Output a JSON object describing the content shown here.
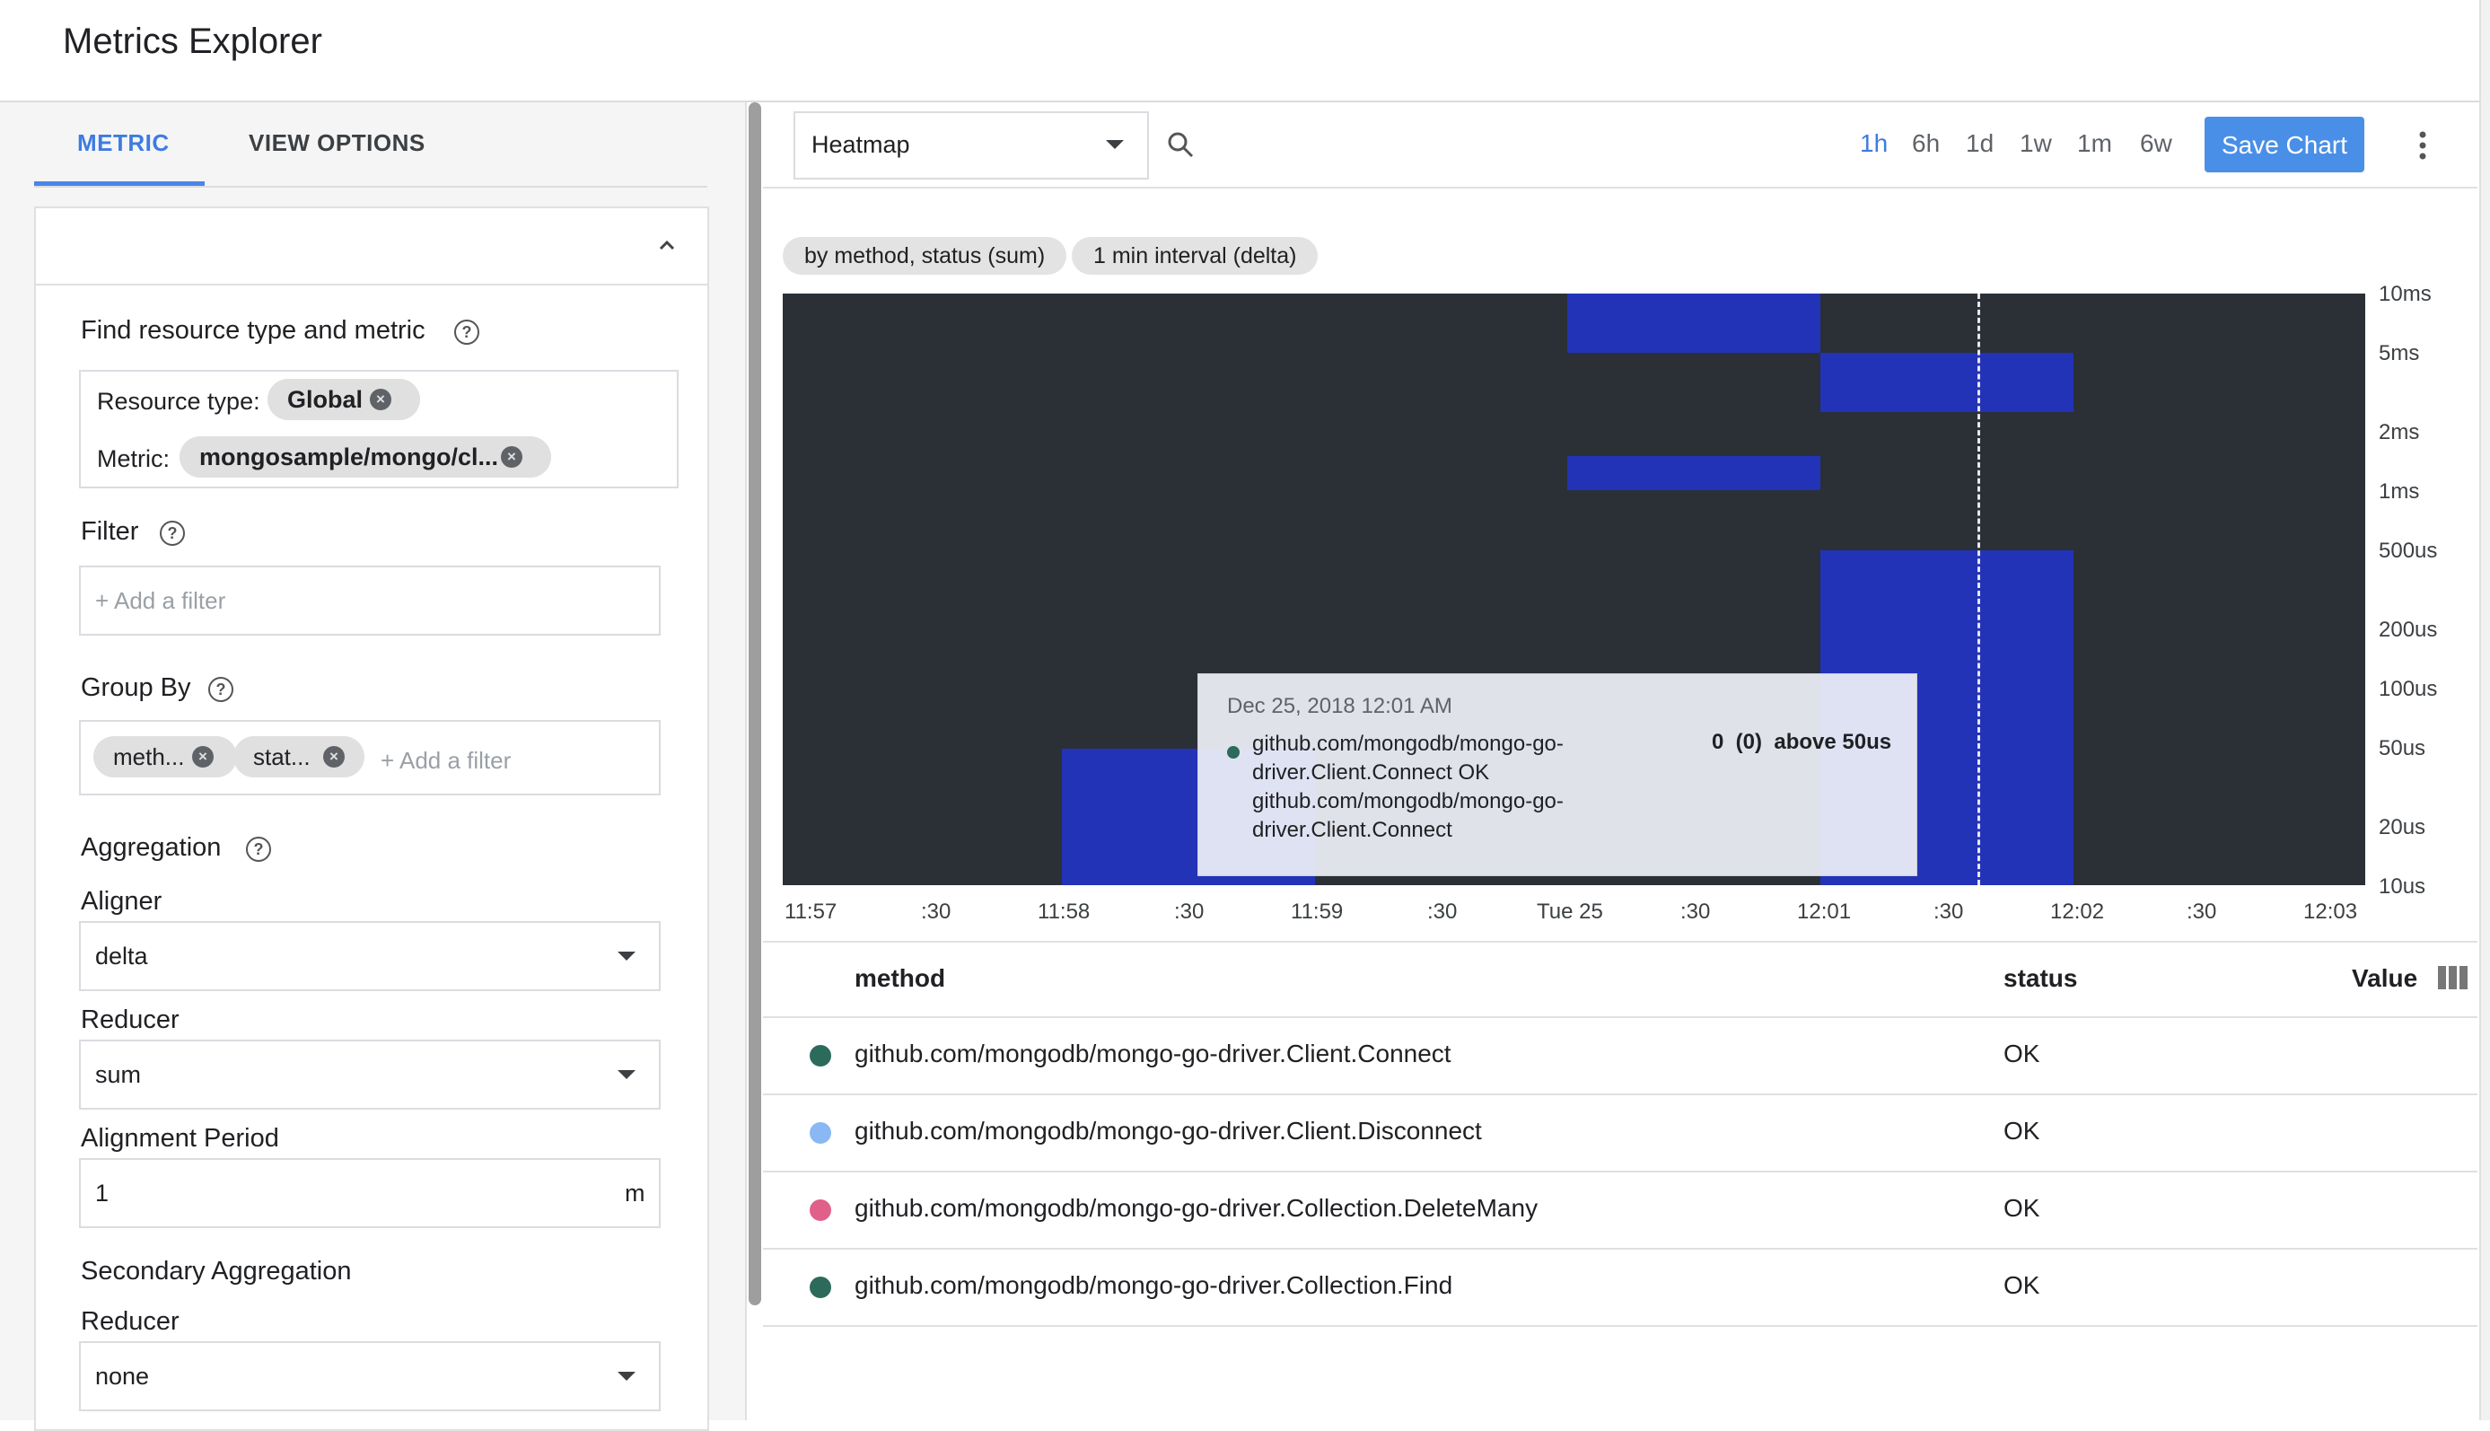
{
  "header": {
    "title": "Metrics Explorer"
  },
  "left": {
    "tabs": [
      "METRIC",
      "VIEW OPTIONS"
    ],
    "find_label": "Find resource type and metric",
    "resource_type_label": "Resource type:",
    "resource_type_value": "Global",
    "metric_label": "Metric:",
    "metric_value": "mongosample/mongo/cl...",
    "filter_label": "Filter",
    "filter_placeholder": "+ Add a filter",
    "group_by_label": "Group By",
    "group_by_chips": [
      "meth...",
      "stat..."
    ],
    "group_by_placeholder": "+ Add a filter",
    "aggregation_label": "Aggregation",
    "aligner_label": "Aligner",
    "aligner_value": "delta",
    "reducer_label": "Reducer",
    "reducer_value": "sum",
    "alignment_period_label": "Alignment Period",
    "alignment_period_value": "1",
    "alignment_period_unit": "m",
    "secondary_label": "Secondary Aggregation",
    "secondary_reducer_label": "Reducer",
    "secondary_reducer_value": "none"
  },
  "toolbar": {
    "chart_type": "Heatmap",
    "ranges": [
      "1h",
      "6h",
      "1d",
      "1w",
      "1m",
      "6w"
    ],
    "active_range": "1h",
    "save_label": "Save Chart"
  },
  "pills": [
    "by method, status (sum)",
    "1 min interval (delta)"
  ],
  "chart_data": {
    "type": "heatmap",
    "x_ticks": [
      "11:57",
      ":30",
      "11:58",
      ":30",
      "11:59",
      ":30",
      "Tue 25",
      ":30",
      "12:01",
      ":30",
      "12:02",
      ":30",
      "12:03"
    ],
    "y_ticks": [
      "10ms",
      "5ms",
      "2ms",
      "1ms",
      "500us",
      "200us",
      "100us",
      "50us",
      "20us",
      "10us"
    ],
    "y_scale": "log",
    "cells": [
      {
        "x_start": "11:57:30",
        "x_end": "11:58:30",
        "y_low": "10us",
        "y_high": "50us"
      },
      {
        "x_start": "Tue 25 00:00",
        "x_end": "12:01",
        "y_low": "5ms",
        "y_high": "10ms"
      },
      {
        "x_start": "Tue 25 00:00",
        "x_end": "12:01",
        "y_low": "1ms",
        "y_high": "2ms"
      },
      {
        "x_start": "12:01",
        "x_end": "12:02",
        "y_low": "2ms",
        "y_high": "5ms"
      },
      {
        "x_start": "12:01",
        "x_end": "12:02",
        "y_low": "10us",
        "y_high": "500us"
      }
    ],
    "cursor": "12:01:30",
    "colors": {
      "background": "#2a3036",
      "cell": "#2233b8"
    }
  },
  "tooltip": {
    "time": "Dec 25, 2018 12:01 AM",
    "series": "github.com/mongodb/mongo-go-driver.Client.Connect OK github.com/mongodb/mongo-go-driver.Client.Connect",
    "value": "0  (0)  above 50us"
  },
  "table": {
    "headers": [
      "method",
      "status",
      "Value"
    ],
    "rows": [
      {
        "method": "github.com/mongodb/mongo-go-driver.Client.Connect",
        "status": "OK",
        "color": "#2c6b5b"
      },
      {
        "method": "github.com/mongodb/mongo-go-driver.Client.Disconnect",
        "status": "OK",
        "color": "#8ab8f5"
      },
      {
        "method": "github.com/mongodb/mongo-go-driver.Collection.DeleteMany",
        "status": "OK",
        "color": "#e0608a"
      },
      {
        "method": "github.com/mongodb/mongo-go-driver.Collection.Find",
        "status": "OK",
        "color": "#2c6b5b"
      }
    ]
  }
}
